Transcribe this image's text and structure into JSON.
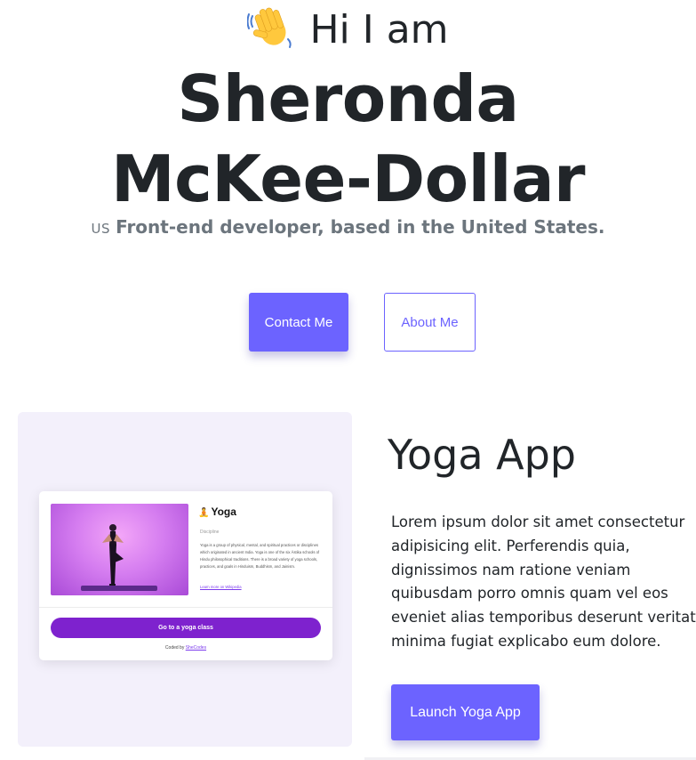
{
  "hero": {
    "wave_icon": "waving-hand-icon",
    "greeting": "Hi I am",
    "name_line1": "Sheronda",
    "name_line2": "McKee-Dollar",
    "flag": "US",
    "tagline": "Front-end developer, based in the United States."
  },
  "actions": {
    "contact_label": "Contact Me",
    "about_label": "About Me"
  },
  "project": {
    "title": "Yoga App",
    "description_lines": [
      "Lorem ipsum dolor sit amet consectetur",
      "adipisicing elit. Perferendis quia,",
      "dignissimos nam ratione veniam",
      "quibusdam porro omnis quam vel eos",
      "eveniet alias temporibus deserunt veritatis",
      "minima fugiat explicabo eum dolore."
    ],
    "launch_label": "Launch Yoga App",
    "preview": {
      "emoji": "🧘",
      "title": "Yoga",
      "discipline": "Discipline",
      "description": "Yoga is a group of physical, mental, and spiritual practices or disciplines which originated in ancient India. Yoga is one of the six Āstika schools of Hindu philosophical traditions. There is a broad variety of yoga schools, practices, and goals in Hinduism, Buddhism, and Jainism.",
      "link": "Learn more on Wikipedia",
      "class_button": "Go to a yoga class",
      "credit_prefix": "Coded by",
      "credit_brand": "SheCodes"
    }
  },
  "colors": {
    "accent": "#6c63ff",
    "panel": "#f3f0fb",
    "yoga_purple": "#7e22ce",
    "text_dark": "#212529",
    "text_muted": "#6c757d"
  }
}
